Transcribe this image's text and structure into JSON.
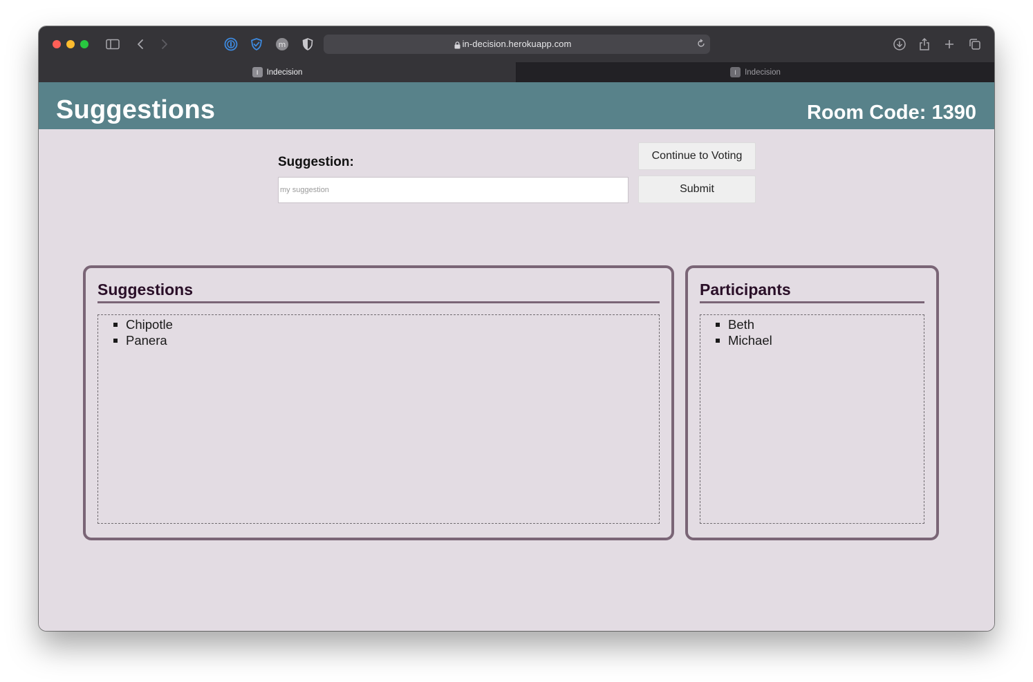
{
  "browser": {
    "url": "in-decision.herokuapp.com",
    "tabs": [
      {
        "label": "Indecision",
        "favicon": "I",
        "active": true
      },
      {
        "label": "Indecision",
        "favicon": "I",
        "active": false
      }
    ]
  },
  "header": {
    "title": "Suggestions",
    "room_code": "Room Code: 1390",
    "color": "#58828a"
  },
  "form": {
    "label": "Suggestion:",
    "input_placeholder": "my suggestion",
    "input_value": "",
    "continue_label": "Continue to Voting",
    "submit_label": "Submit"
  },
  "suggestions_panel": {
    "title": "Suggestions",
    "items": [
      "Chipotle",
      "Panera"
    ]
  },
  "participants_panel": {
    "title": "Participants",
    "items": [
      "Beth",
      "Michael"
    ]
  },
  "colors": {
    "page_bg": "#e3dce3",
    "panel_border": "#7a6576",
    "heading_text": "#2a0f28"
  }
}
